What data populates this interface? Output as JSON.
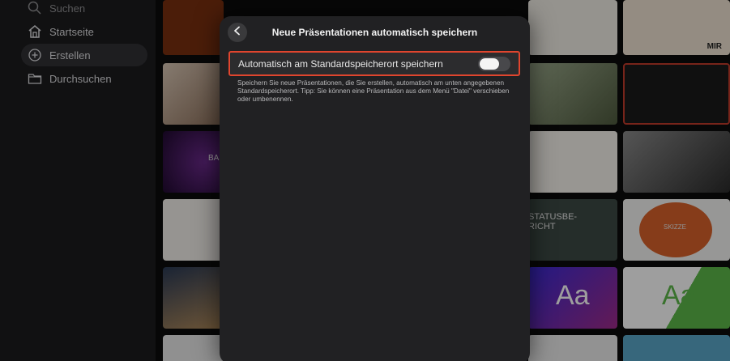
{
  "sidebar": {
    "items": [
      {
        "label": "Suchen",
        "icon": "search-icon"
      },
      {
        "label": "Startseite",
        "icon": "home-icon"
      },
      {
        "label": "Erstellen",
        "icon": "plus-circle-icon",
        "active": true
      },
      {
        "label": "Durchsuchen",
        "icon": "folder-icon"
      }
    ]
  },
  "thumbnails": {
    "statusbericht": "STATUSBE-\nRICHT",
    "skizze": "SKIZZE",
    "aa_1": "Aa",
    "aa_2": "Aa",
    "ba": "BA",
    "mir": "MIR"
  },
  "modal": {
    "title": "Neue Präsentationen automatisch speichern",
    "toggle_label": "Automatisch am Standardspeicherort speichern",
    "toggle_state": false,
    "help_text": "Speichern Sie neue Präsentationen, die Sie erstellen, automatisch am unten angegebenen Standardspeicherort. Tipp: Sie können eine Präsentation aus dem Menü \"Datei\" verschieben oder umbenennen.",
    "accent_color": "#e0452e"
  }
}
